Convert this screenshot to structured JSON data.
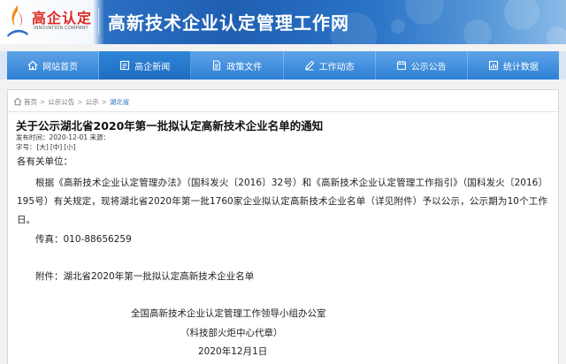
{
  "header": {
    "logo_text": "高企认定",
    "logo_subtext": "INNOVATION COMPANY",
    "site_title": "高新技术企业认定管理工作网"
  },
  "nav": {
    "items": [
      {
        "label": "网站首页",
        "icon": "home-icon"
      },
      {
        "label": "高企新闻",
        "icon": "news-icon"
      },
      {
        "label": "政策文件",
        "icon": "document-icon"
      },
      {
        "label": "工作动态",
        "icon": "pencil-icon"
      },
      {
        "label": "公示公告",
        "icon": "announcement-icon"
      },
      {
        "label": "统计数据",
        "icon": "stats-icon"
      }
    ],
    "active_index": 1
  },
  "breadcrumb": {
    "items": [
      "首页",
      "公示公告",
      "公示"
    ],
    "current": "湖北省",
    "separator": ">"
  },
  "article": {
    "title": "关于公示湖北省2020年第一批拟认定高新技术企业名单的通知",
    "meta": "发布时间：2020-12-01 来源：",
    "fontsize_label": "字号：",
    "fontsize_options": [
      "[大]",
      "[中]",
      "[小]"
    ],
    "salutation": "各有关单位：",
    "paragraph": "根据《高新技术企业认定管理办法》（国科发火〔2016〕32号）和《高新技术企业认定管理工作指引》（国科发火〔2016〕195号）有关规定，现将湖北省2020年第一批1760家企业拟认定高新技术企业名单（详见附件）予以公示，公示期为10个工作日。",
    "fax": "传真：010-88656259",
    "attachment": "附件：湖北省2020年第一批拟认定高新技术企业名单",
    "signature_org": "全国高新技术企业认定管理工作领导小组办公室",
    "signature_note": "（科技部火炬中心代章）",
    "date": "2020年12月1日"
  },
  "colors": {
    "nav_blue": "#2d7fd4",
    "nav_active": "#1f6cc0",
    "header_blue": "#1f5fb2",
    "logo_red": "#e02a24",
    "breadcrumb_current": "#2d6fbe"
  }
}
